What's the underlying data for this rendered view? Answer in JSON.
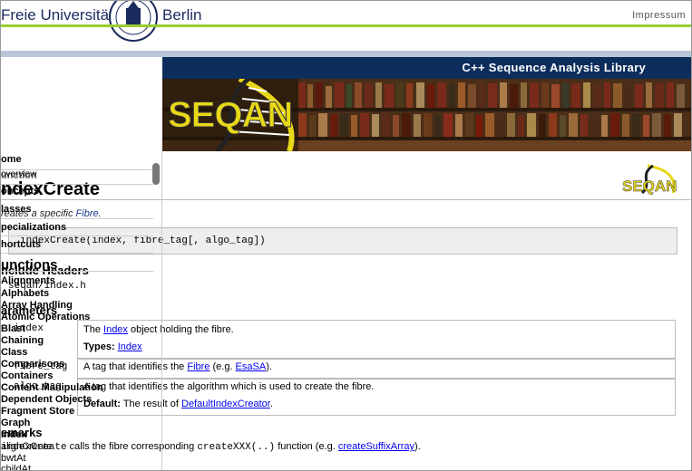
{
  "header": {
    "university_left": "Freie Universität",
    "university_right": "Berlin",
    "impressum": "Impressum"
  },
  "banner": {
    "title": "C++ Sequence Analysis Library",
    "logo_text": "SEQAN"
  },
  "sidebar": {
    "items": [
      "ome",
      "unction",
      "oncepts",
      "lasses",
      "pecializations",
      "hortcuts",
      "unctions",
      "nclude Headers",
      "Alignments",
      "Alphabets",
      "arameters",
      "Array Handling",
      "Atomic Operations",
      "Blast",
      "Chaining",
      "Class",
      "Comparisons",
      "Containers",
      "Content Manipulation",
      "Dependent Objects",
      "Fragment Store",
      "Graph",
      "emarks",
      "Index",
      "alignCreate",
      "bwtAt",
      "childAt"
    ],
    "overlay_text": "overview"
  },
  "main": {
    "page_title": "ndexCreate",
    "desc_prefix": "reates a specific ",
    "desc_link": "Fibre",
    "desc_suffix": ".",
    "signature": "indexCreate(index, fibre_tag[, algo_tag])",
    "include_heading": "nclude Headers",
    "include_file": "seqan/index.h",
    "params_heading": "arameters",
    "param1_name": "index",
    "param1_desc_prefix": "The ",
    "param1_link": "Index",
    "param1_desc_suffix": " object holding the fibre.",
    "param1_types_label": "Types:",
    "param1_types_value": "Index",
    "param2_name": "fibre_tag",
    "param2_desc_prefix": "A tag that identifies the ",
    "param2_link": "Fibre",
    "param2_desc_mid": " (e.g. ",
    "param2_link2": "EsaSA",
    "param2_desc_suffix": ").",
    "param3_name": "algo_tag",
    "param3_desc": "A tag that identifies the algorithm which is used to create the fibre.",
    "param3_default_label": "Default:",
    "param3_default_prefix": "The result of ",
    "param3_default_link": "DefaultIndexCreator",
    "param3_default_suffix": ".",
    "remarks_heading": "emarks",
    "remarks_code": "indexCreate",
    "remarks_text1": " calls the fibre corresponding ",
    "remarks_code2": "createXXX(..)",
    "remarks_text2": " function (e.g. ",
    "remarks_link": "createSuffixArray",
    "remarks_text3": ")."
  },
  "colors": {
    "navy": "#0d2e5c",
    "green": "#99cc33",
    "link": "#1a3a8a"
  }
}
